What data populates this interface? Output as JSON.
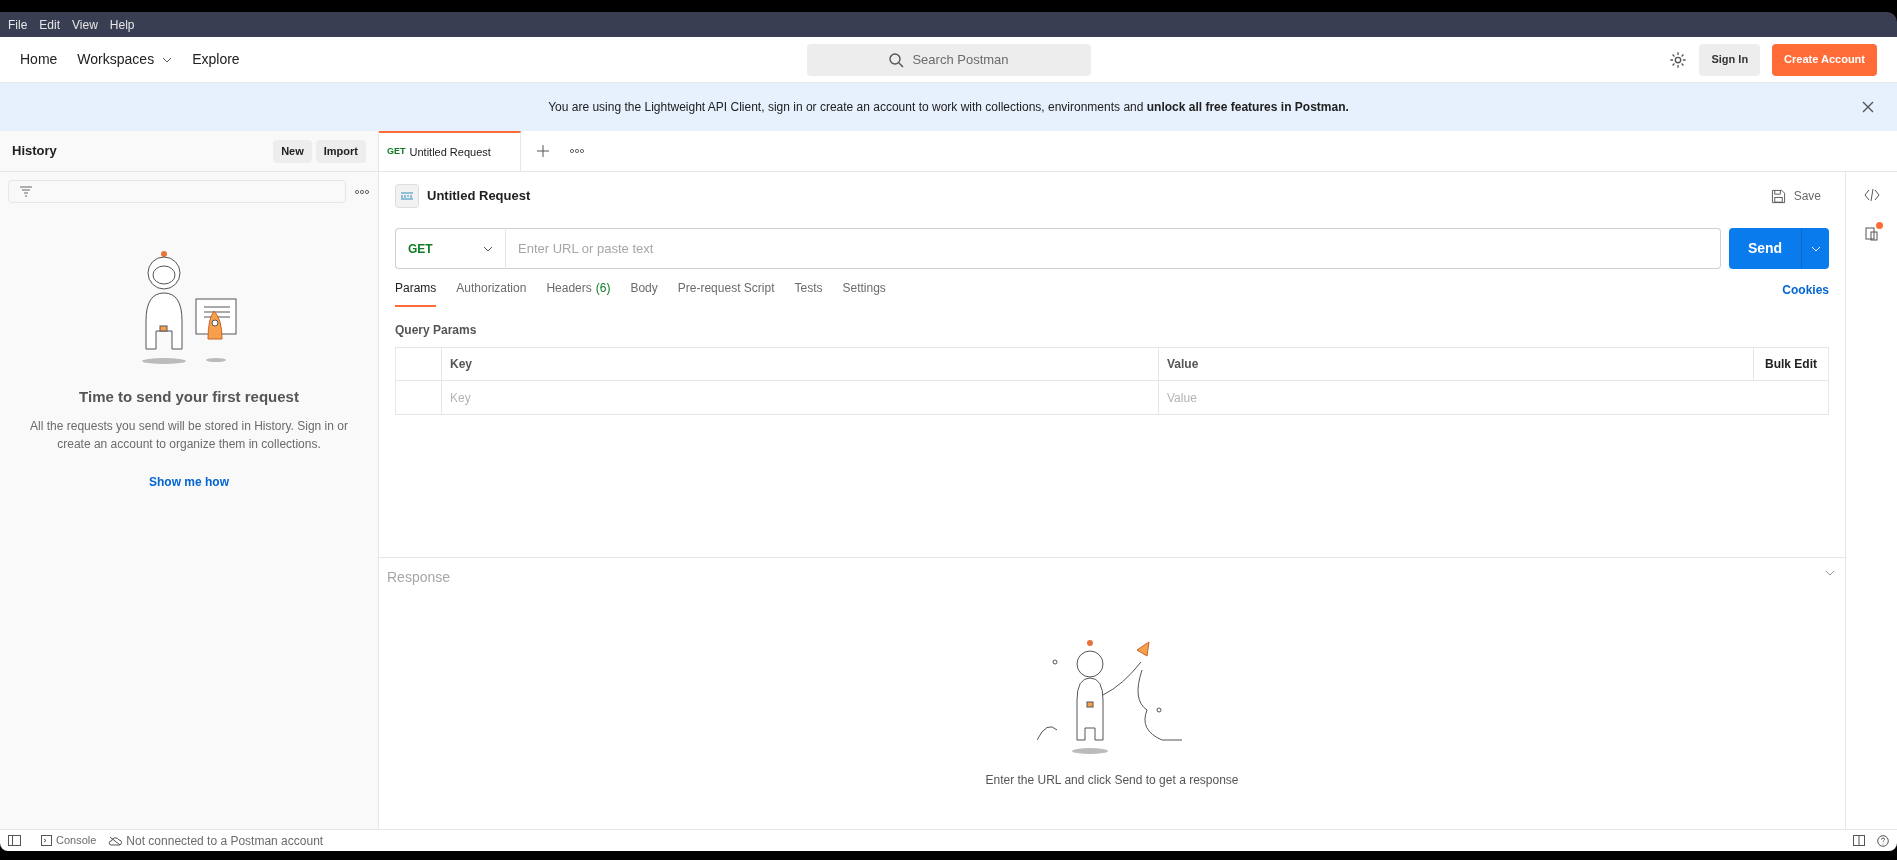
{
  "menu_bar": [
    "File",
    "Edit",
    "View",
    "Help"
  ],
  "header": {
    "nav": [
      {
        "label": "Home",
        "dropdown": false
      },
      {
        "label": "Workspaces",
        "dropdown": true
      },
      {
        "label": "Explore",
        "dropdown": false
      }
    ],
    "search": {
      "placeholder": "Search Postman"
    },
    "sign_in": "Sign In",
    "create_account": "Create Account"
  },
  "banner": {
    "text": "You are using the Lightweight API Client, sign in or create an account to work with collections, environments and **unlock all free features in Postman.**"
  },
  "sidebar": {
    "title": "History",
    "buttons": [
      "New",
      "Import"
    ],
    "empty_title": "Time to send your first request",
    "empty_text": "All the requests you send will be stored in History. Sign in or create an account to organize them in collections.",
    "link": "Show me how"
  },
  "request_tabs": [
    {
      "method": "GET",
      "label": "Untitled Request",
      "selected": true
    }
  ],
  "request": {
    "name": "Untitled Request",
    "save": "Save",
    "method": "GET",
    "url_placeholder": "Enter URL or paste text",
    "send": "Send",
    "tabs": [
      {
        "label": "Params",
        "selected": true
      },
      {
        "label": "Authorization",
        "selected": false
      },
      {
        "label": "Headers",
        "count": "(6)",
        "selected": false
      },
      {
        "label": "Body",
        "selected": false
      },
      {
        "label": "Pre-request Script",
        "selected": false
      },
      {
        "label": "Tests",
        "selected": false
      },
      {
        "label": "Settings",
        "selected": false
      }
    ],
    "cookies": "Cookies",
    "section": "Query Params",
    "table": {
      "columns": [
        "Key",
        "Value"
      ],
      "bulk_edit": "Bulk Edit",
      "placeholders": [
        "Key",
        "Value"
      ]
    }
  },
  "response": {
    "title": "Response",
    "hint": "Enter the URL and click Send to get a response"
  },
  "status_bar": {
    "console": "Console",
    "connection": "Not connected to a Postman account"
  }
}
